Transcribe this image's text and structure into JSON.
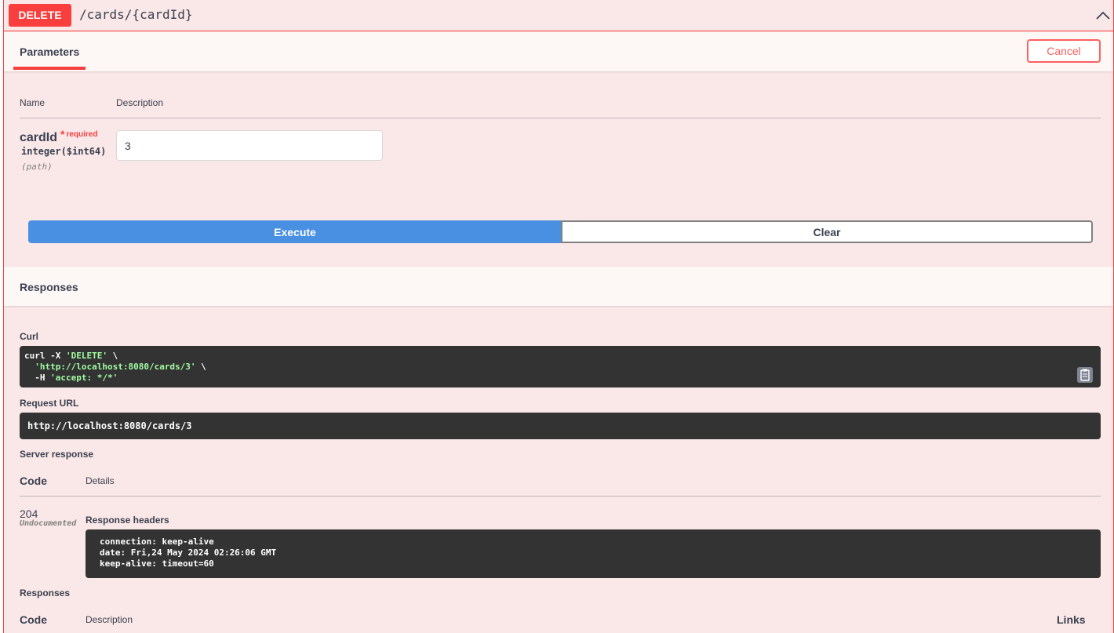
{
  "operation": {
    "method": "DELETE",
    "path": "/cards/{cardId}"
  },
  "colors": {
    "delete_accent": "#f93e3e",
    "execute_blue": "#4990e2",
    "block_background": "#fae7e7",
    "code_background": "#333333",
    "code_string": "#a2fca2"
  },
  "params_tab": {
    "label": "Parameters",
    "cancel_label": "Cancel"
  },
  "params_table": {
    "col_name": "Name",
    "col_description": "Description"
  },
  "parameter": {
    "name": "cardId",
    "required_star": "*",
    "required_text": "required",
    "type": "integer($int64)",
    "location": "(path)",
    "value": "3"
  },
  "actions": {
    "execute_label": "Execute",
    "clear_label": "Clear"
  },
  "responses_section": {
    "title": "Responses"
  },
  "curl": {
    "label": "Curl",
    "line1_cmd": "curl -X ",
    "line1_str": "'DELETE'",
    "line1_tail": " \\",
    "line2_pad": "  ",
    "line2_str": "'http://localhost:8080/cards/3'",
    "line2_tail": " \\",
    "line3_cmd": "  -H ",
    "line3_str": "'accept: */*'",
    "copy_icon": "clipboard-icon"
  },
  "request_url": {
    "label": "Request URL",
    "value": "http://localhost:8080/cards/3"
  },
  "server_response": {
    "label": "Server response",
    "col_code": "Code",
    "col_details": "Details",
    "status_code": "204",
    "status_note": "Undocumented",
    "headers_label": "Response headers",
    "headers": [
      "connection: keep-alive",
      "date: Fri,24 May 2024 02:26:06 GMT",
      "keep-alive: timeout=60"
    ]
  },
  "responses_table": {
    "label": "Responses",
    "col_code": "Code",
    "col_description": "Description",
    "col_links": "Links"
  }
}
